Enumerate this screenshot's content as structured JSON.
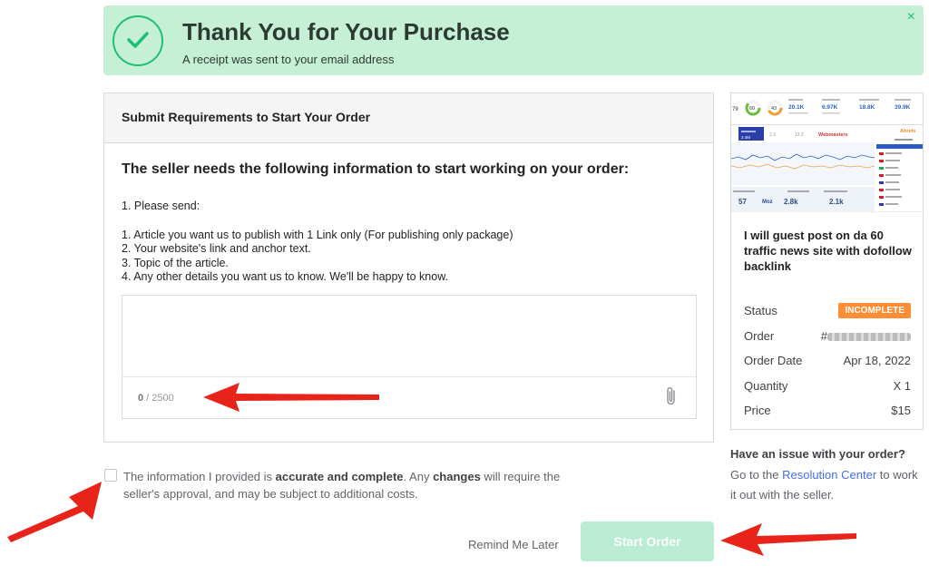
{
  "banner": {
    "title": "Thank You for Your Purchase",
    "subtitle": "A receipt was sent to your email address",
    "close": "×"
  },
  "requirements": {
    "header": "Submit Requirements to Start Your Order",
    "heading": "The seller needs the following information to start working on your order:",
    "intro": "1. Please send:",
    "items": [
      "1. Article you want us to publish with 1 Link only (For publishing only package)",
      "2. Your website's link and anchor text.",
      "3. Topic of the article.",
      "4. Any other details you want us to know. We'll be happy to know."
    ],
    "textarea_value": "",
    "counter_current": "0",
    "counter_max": " / 2500"
  },
  "agreement": {
    "text_1": "The information I provided is ",
    "text_bold_1": "accurate and complete",
    "text_2": ". Any ",
    "text_bold_2": "changes",
    "text_3": " will require the seller's approval, and may be subject to additional costs."
  },
  "actions": {
    "remind_label": "Remind Me Later",
    "start_label": "Start Order"
  },
  "order": {
    "gig_title": "I will guest post on da 60 traffic news site with dofollow backlink",
    "status_label": "Status",
    "status_value": "INCOMPLETE",
    "order_label": "Order",
    "order_prefix": "#",
    "date_label": "Order Date",
    "date_value": "Apr 18, 2022",
    "qty_label": "Quantity",
    "qty_value": "X 1",
    "price_label": "Price",
    "price_value": "$15"
  },
  "thumbnail": {
    "metric_1": "60",
    "metric_2": "43",
    "stat_1": "20.1K",
    "stat_2": "6.97K",
    "stat_3": "18.8K",
    "stat_4": "39.9K",
    "tab_label": "Webmasters",
    "brand": "Ahrefs",
    "bottom_1": "57",
    "bottom_2": "Moz",
    "bottom_3": "2.8k",
    "bottom_4": "2.1k"
  },
  "issue": {
    "title": "Have an issue with your order?",
    "text_1": "Go to the ",
    "link": "Resolution Center",
    "text_2": " to work it out with the seller."
  },
  "colors": {
    "brand_green": "#1dbf73",
    "banner_bg": "#c6f0d6",
    "badge_orange": "#ff8d33",
    "link_blue": "#446ee7",
    "arrow_red": "#e8231a"
  }
}
